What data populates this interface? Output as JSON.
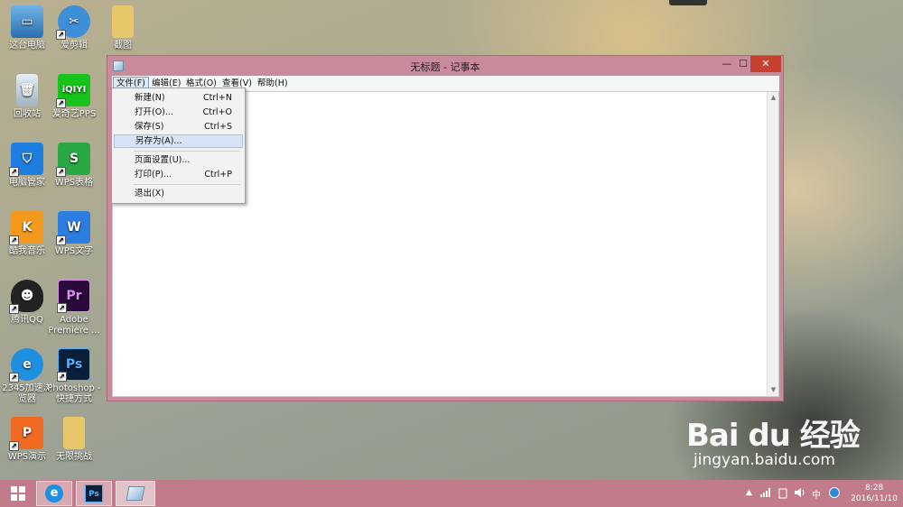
{
  "desktop": {
    "icons": [
      {
        "label": "这台电脑",
        "icon": "computer-icon"
      },
      {
        "label": "爱剪辑",
        "icon": "video-edit-icon"
      },
      {
        "label": "截图",
        "icon": "folder-icon"
      },
      {
        "label": "回收站",
        "icon": "recycle-bin-icon"
      },
      {
        "label": "爱奇艺PPS",
        "icon": "iqiyi-icon"
      },
      {
        "label": "电脑管家",
        "icon": "shield-icon"
      },
      {
        "label": "WPS表格",
        "icon": "wps-sheet-icon"
      },
      {
        "label": "酷我音乐",
        "icon": "music-icon"
      },
      {
        "label": "WPS文字",
        "icon": "wps-writer-icon"
      },
      {
        "label": "腾讯QQ",
        "icon": "qq-icon"
      },
      {
        "label": "Adobe Premiere ...",
        "icon": "premiere-icon"
      },
      {
        "label": "2345加速浏览器",
        "icon": "browser-icon"
      },
      {
        "label": "Photoshop - 快捷方式",
        "icon": "photoshop-icon"
      },
      {
        "label": "WPS演示",
        "icon": "wps-present-icon"
      },
      {
        "label": "无限挑战",
        "icon": "folder-icon"
      }
    ]
  },
  "window": {
    "title": "无标题 - 记事本",
    "min_label": "—",
    "max_label": "☐",
    "close_label": "✕",
    "menu": [
      {
        "label": "文件(F)"
      },
      {
        "label": "编辑(E)"
      },
      {
        "label": "格式(O)"
      },
      {
        "label": "查看(V)"
      },
      {
        "label": "帮助(H)"
      }
    ]
  },
  "file_menu": {
    "items": [
      {
        "label": "新建(N)",
        "shortcut": "Ctrl+N"
      },
      {
        "label": "打开(O)...",
        "shortcut": "Ctrl+O"
      },
      {
        "label": "保存(S)",
        "shortcut": "Ctrl+S"
      },
      {
        "label": "另存为(A)...",
        "shortcut": ""
      },
      {
        "label": "页面设置(U)...",
        "shortcut": ""
      },
      {
        "label": "打印(P)...",
        "shortcut": "Ctrl+P"
      },
      {
        "label": "退出(X)",
        "shortcut": ""
      }
    ],
    "highlighted": "另存为(A)..."
  },
  "taskbar": {
    "clock_time": "8:28",
    "clock_date": "2016/11/10",
    "ime": "中",
    "tray_arrow": "▲"
  },
  "watermark": {
    "logo": "Bai du 经验",
    "url": "jingyan.baidu.com"
  },
  "colors": {
    "window_frame": "#c98a9b",
    "taskbar": "#c27b8b",
    "close_button": "#c7402f",
    "menu_highlight": "#d6e4f5"
  }
}
